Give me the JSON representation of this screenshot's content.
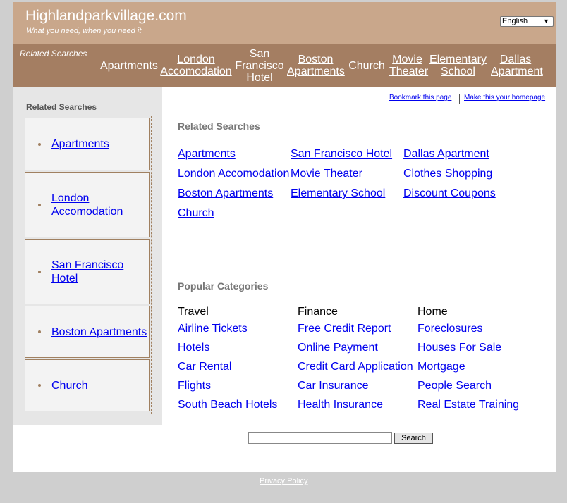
{
  "header": {
    "site_title": "Highlandparkvillage.com",
    "tagline": "What you need, when you need it",
    "language": "English"
  },
  "topnav": {
    "label": "Related Searches",
    "links": [
      "Apartments",
      "London Accomodation",
      "San Francisco Hotel",
      "Boston Apartments",
      "Church",
      "Movie Theater",
      "Elementary School",
      "Dallas Apartment"
    ]
  },
  "sidebar": {
    "title": "Related Searches",
    "items": [
      "Apartments",
      "London Accomodation",
      "San Francisco Hotel",
      "Boston Apartments",
      "Church"
    ]
  },
  "toolbar": {
    "bookmark": "Bookmark this page",
    "homepage": "Make this your homepage"
  },
  "related": {
    "title": "Related Searches",
    "columns": [
      [
        "Apartments",
        "London Accomodation",
        "Boston Apartments",
        "Church"
      ],
      [
        "San Francisco Hotel",
        "Movie Theater",
        "Elementary School"
      ],
      [
        "Dallas Apartment",
        "Clothes Shopping",
        "Discount Coupons"
      ]
    ]
  },
  "popular": {
    "title": "Popular Categories",
    "categories": [
      {
        "name": "Travel",
        "links": [
          "Airline Tickets",
          "Hotels",
          "Car Rental",
          "Flights",
          "South Beach Hotels"
        ]
      },
      {
        "name": "Finance",
        "links": [
          "Free Credit Report",
          "Online Payment",
          "Credit Card Application",
          "Car Insurance",
          "Health Insurance"
        ]
      },
      {
        "name": "Home",
        "links": [
          "Foreclosures",
          "Houses For Sale",
          "Mortgage",
          "People Search",
          "Real Estate Training"
        ]
      }
    ]
  },
  "search": {
    "value": "",
    "button_label": "Search"
  },
  "footer": {
    "privacy": "Privacy Policy"
  }
}
